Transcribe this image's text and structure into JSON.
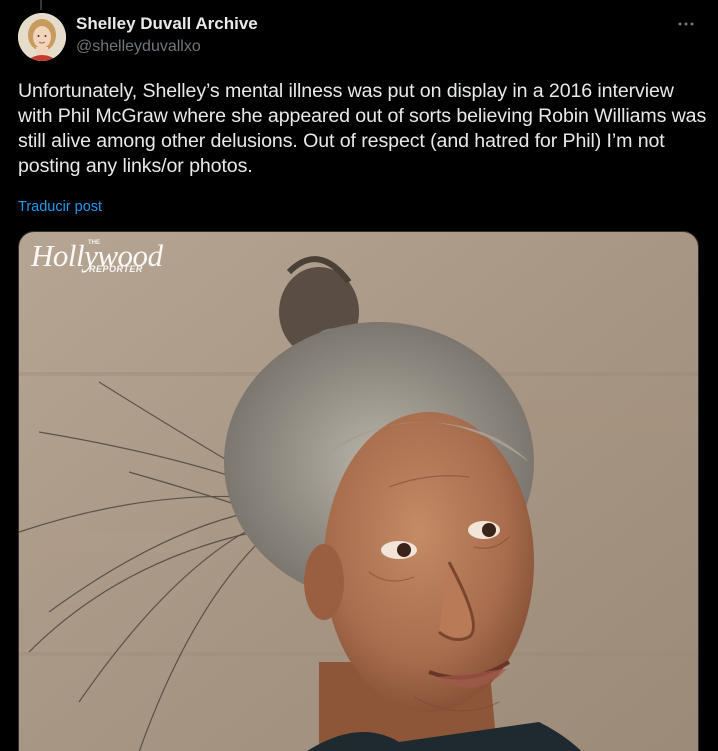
{
  "author": {
    "display_name": "Shelley Duvall Archive",
    "handle": "@shelleyduvallxo"
  },
  "post": {
    "text": "Unfortunately, Shelley’s mental illness was put on display in a 2016 interview with Phil McGraw where she appeared out of sorts believing Robin Williams was still alive among other delusions. Out of respect (and hatred for Phil) I’m not posting any links/or photos.",
    "translate_label": "Traducir post"
  },
  "media": {
    "logo_main": "Hollywood",
    "logo_the": "THE",
    "logo_sub": "REPORTER"
  },
  "icons": {
    "more": "more-horizontal-icon"
  },
  "colors": {
    "background": "#000000",
    "text_primary": "#e7e9ea",
    "text_secondary": "#71767b",
    "link": "#1d9bf0"
  }
}
